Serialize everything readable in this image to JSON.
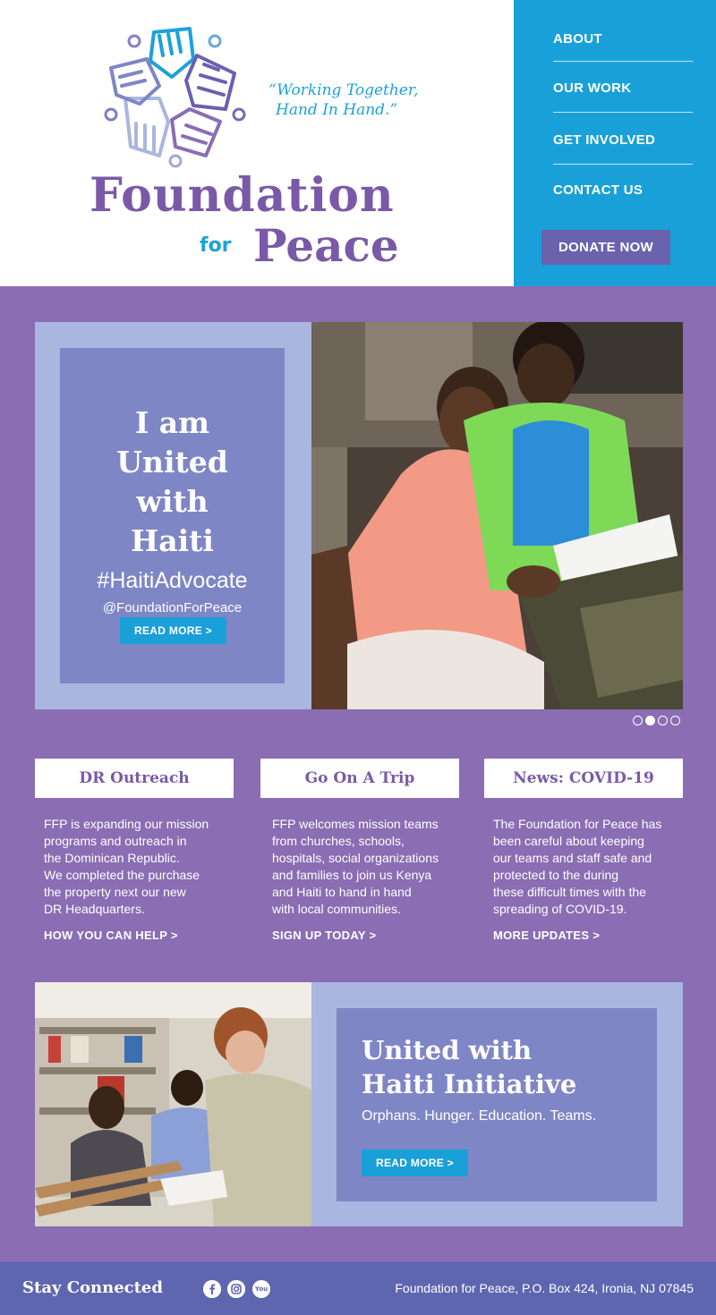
{
  "header": {
    "tagline_line1": "“Working Together,",
    "tagline_line2": "Hand In Hand.”",
    "logo_word1": "Foundation",
    "logo_word2": "for",
    "logo_word3": "Peace"
  },
  "nav": {
    "items": [
      {
        "label": "ABOUT"
      },
      {
        "label": "OUR WORK"
      },
      {
        "label": "GET INVOLVED"
      },
      {
        "label": "CONTACT US"
      }
    ],
    "donate_label": "DONATE NOW"
  },
  "hero": {
    "title_lines": [
      "I am",
      "United",
      "with",
      "Haiti"
    ],
    "hashtag": "#HaitiAdvocate",
    "handle": "@FoundationForPeace",
    "button_label": "READ MORE >",
    "slide_count": 4,
    "active_slide": 2
  },
  "cards": [
    {
      "title": "DR Outreach",
      "body_lines": [
        "FFP is expanding our mission",
        "programs and outreach in",
        "the Dominican Republic.",
        "We completed the purchase",
        "the property next our new",
        "DR Headquarters."
      ],
      "link": "HOW YOU CAN HELP >"
    },
    {
      "title": "Go On A Trip",
      "body_lines": [
        "FFP welcomes mission teams",
        "from churches, schools,",
        "hospitals, social organizations",
        "and families to join us Kenya",
        "and Haiti to hand in hand",
        "with local communities."
      ],
      "link": "SIGN UP TODAY >"
    },
    {
      "title": "News: COVID-19",
      "body_lines": [
        "The Foundation for Peace has",
        "been careful about keeping",
        "our teams and staff safe and",
        "protected to the during",
        "these difficult times with the",
        "spreading of COVID-19."
      ],
      "link": "MORE UPDATES >"
    }
  ],
  "initiative": {
    "title_line1": "United with",
    "title_line2": "Haiti Initiative",
    "subtitle": "Orphans. Hunger. Education. Teams.",
    "button_label": "READ MORE >"
  },
  "footer": {
    "stay_connected": "Stay Connected",
    "social_icons": [
      "facebook-icon",
      "instagram-icon",
      "youtube-icon"
    ],
    "youtube_text": "You",
    "address": "Foundation for Peace, P.O. Box 424, Ironia, NJ 07845"
  },
  "colors": {
    "purple_bg": "#8a6db3",
    "brand_purple": "#7a5aa8",
    "brand_blue": "#1aa0d8",
    "panel_lilac": "#a9b6e0",
    "panel_periwinkle": "#7f86c5",
    "footer": "#5e66b0"
  }
}
